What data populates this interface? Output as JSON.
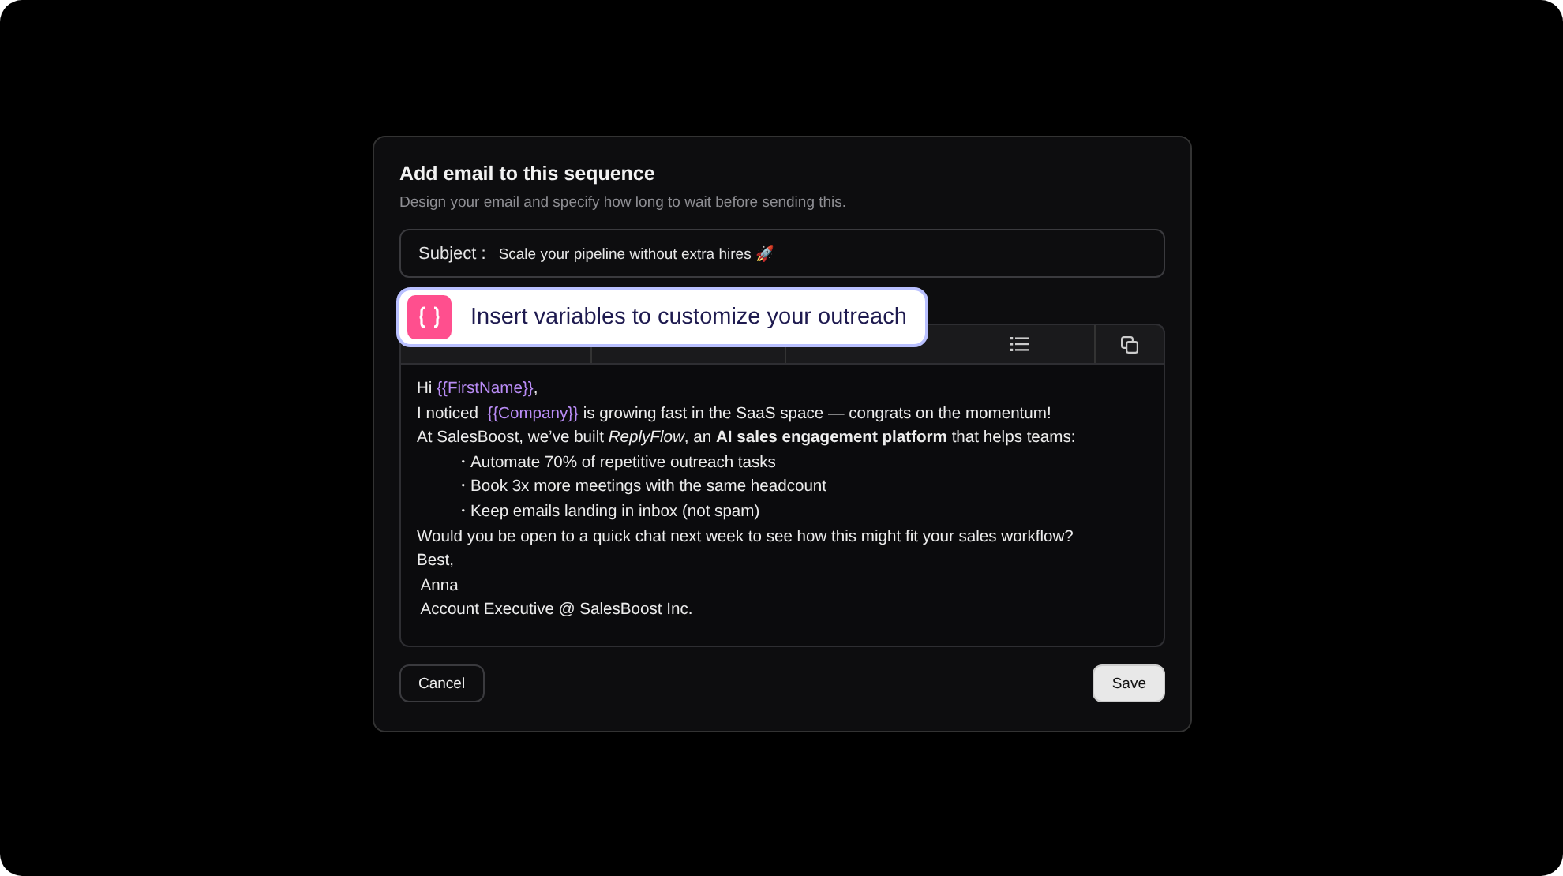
{
  "dialog": {
    "title": "Add email to this sequence",
    "subtitle": "Design your email and specify how long to wait before sending this.",
    "subject": {
      "label": "Subject :",
      "value": "Scale your pipeline without extra hires 🚀"
    },
    "tooltip": {
      "text": "Insert variables to customize your outreach"
    },
    "body": [
      {
        "kind": "line",
        "parts": [
          {
            "kind": "text",
            "text": "Hi "
          },
          {
            "kind": "variable",
            "text": "{{FirstName}}"
          },
          {
            "kind": "text",
            "text": ","
          }
        ]
      },
      {
        "kind": "line",
        "parts": [
          {
            "kind": "text",
            "text": "I noticed  "
          },
          {
            "kind": "variable",
            "text": "{{Company}}"
          },
          {
            "kind": "text",
            "text": " is growing fast in the SaaS space — congrats on the momentum!"
          }
        ]
      },
      {
        "kind": "line",
        "parts": [
          {
            "kind": "text",
            "text": "At SalesBoost, we’ve built *ReplyFlow*, an **AI sales engagement platform** that helps teams:"
          }
        ]
      },
      {
        "kind": "bullet",
        "parts": [
          {
            "kind": "text",
            "text": "・Automate 70% of repetitive outreach tasks"
          }
        ]
      },
      {
        "kind": "bullet",
        "parts": [
          {
            "kind": "text",
            "text": "・Book 3x more meetings with the same headcount"
          }
        ]
      },
      {
        "kind": "bullet",
        "parts": [
          {
            "kind": "text",
            "text": "・Keep emails landing in inbox (not spam)"
          }
        ]
      },
      {
        "kind": "line",
        "parts": [
          {
            "kind": "text",
            "text": "Would you be open to a quick chat next week to see how this might fit your sales workflow?"
          }
        ]
      },
      {
        "kind": "line",
        "parts": [
          {
            "kind": "text",
            "text": "Best,"
          }
        ]
      },
      {
        "kind": "line",
        "parts": [
          {
            "kind": "text",
            "text": " Anna"
          }
        ]
      },
      {
        "kind": "line",
        "parts": [
          {
            "kind": "text",
            "text": " Account Executive @ SalesBoost Inc."
          }
        ]
      }
    ],
    "buttons": [
      {
        "kind": "secondary",
        "label": "Cancel"
      },
      {
        "kind": "primary",
        "label": "Save"
      }
    ]
  }
}
